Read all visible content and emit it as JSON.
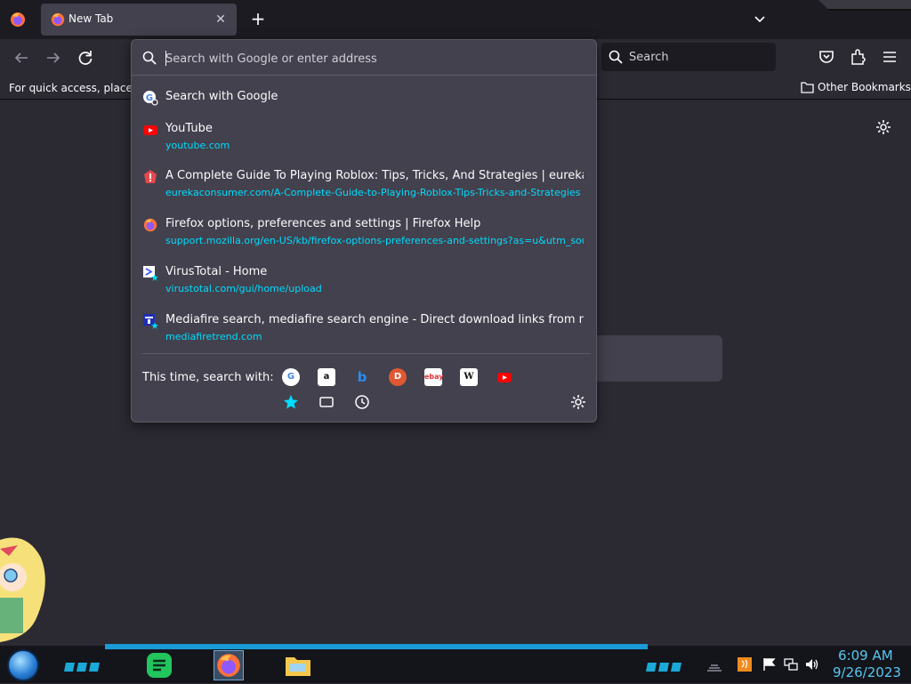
{
  "tabbar": {
    "tab_title": "New Tab"
  },
  "toolbar": {
    "search_label": "Search"
  },
  "bookmarks": {
    "hint": "For quick access, place yo",
    "other_label": "Other Bookmarks"
  },
  "urlbar": {
    "placeholder": "Search with Google or enter address",
    "results": [
      {
        "title": "Search with Google",
        "url": "",
        "icon": "google-search-icon"
      },
      {
        "title": "YouTube",
        "url": "youtube.com",
        "icon": "youtube-icon"
      },
      {
        "title": "A Complete Guide To Playing Roblox: Tips, Tricks, And Strategies | eurekaconsumer.com",
        "url": "eurekaconsumer.com/A-Complete-Guide-to-Playing-Roblox-Tips-Tricks-and-Strategies",
        "icon": "eureka-icon"
      },
      {
        "title": "Firefox options, preferences and settings | Firefox Help",
        "url": "support.mozilla.org/en-US/kb/firefox-options-preferences-and-settings?as=u&utm_source",
        "icon": "firefox-icon"
      },
      {
        "title": "VirusTotal - Home",
        "url": "virustotal.com/gui/home/upload",
        "icon": "virustotal-icon"
      },
      {
        "title": "Mediafire search, mediafire search engine - Direct download links from mediafire",
        "url": "mediafiretrend.com",
        "icon": "mediafiretrend-icon"
      }
    ],
    "oneoff_label": "This time, search with:",
    "engines": [
      "Google",
      "Amazon",
      "Bing",
      "DuckDuckGo",
      "eBay",
      "Wikipedia",
      "YouTube"
    ]
  },
  "taskbar": {
    "time": "6:09 AM",
    "date": "9/26/2023"
  },
  "colors": {
    "accent": "#00ddff",
    "clock": "#58c7f2",
    "popup_bg": "#42414d",
    "chrome_bg": "#2b2a33"
  }
}
